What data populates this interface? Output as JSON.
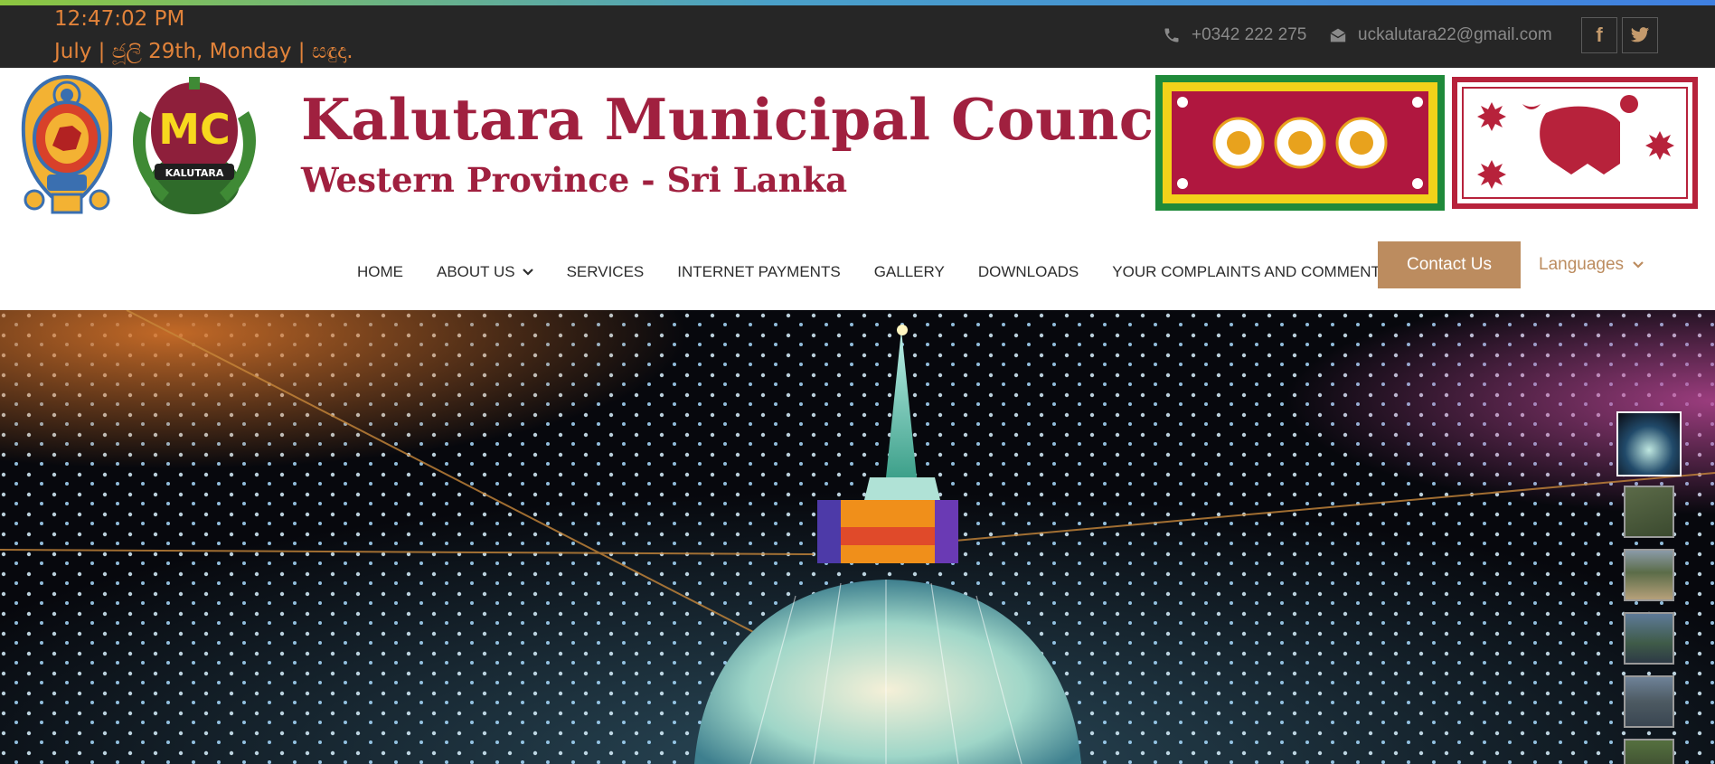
{
  "topbar": {
    "time": "12:47:02 PM",
    "date": "July | ජූලි 29th, Monday | සඳුදා.",
    "phone": "+0342 222 275",
    "email": "uckalutara22@gmail.com",
    "social": [
      {
        "name": "facebook-icon",
        "glyph": "f"
      },
      {
        "name": "twitter-icon",
        "glyph": "t"
      }
    ]
  },
  "header": {
    "title": "Kalutara Municipal Council",
    "subtitle": "Western Province - Sri Lanka",
    "logo_text": "MC",
    "logo_caption": "KALUTARA"
  },
  "nav": {
    "items": [
      "HOME",
      "ABOUT US",
      "SERVICES",
      "INTERNET PAYMENTS",
      "GALLERY",
      "DOWNLOADS",
      "YOUR COMPLAINTS AND COMMENTS"
    ],
    "contact_button": "Contact Us",
    "languages": "Languages"
  },
  "hero": {
    "thumbnails": [
      "stupa-lights",
      "aerial-view",
      "beach",
      "river-bridge",
      "bridge",
      "park"
    ]
  },
  "colors": {
    "accent": "#bc8c5f",
    "brand": "#a0203f",
    "topbar_bg": "#262626",
    "clock": "#e2833a"
  }
}
